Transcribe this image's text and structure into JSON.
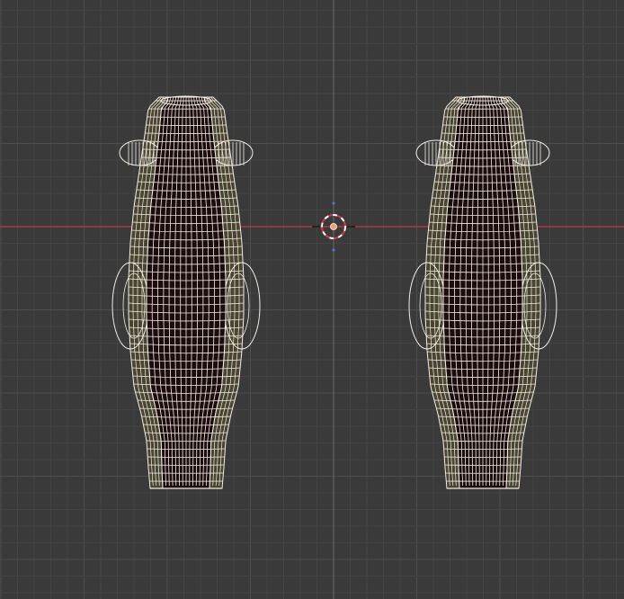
{
  "viewport": {
    "view": "orthographic-front",
    "shading": "wireframe",
    "colors": {
      "background": "#3a3a3a",
      "grid_minor": "#444444",
      "grid_major": "#4e4e4e",
      "x_axis": "#c0394a",
      "z_axis": "#4a78c0",
      "mesh_fill": "#1c0c0e",
      "mesh_side": "#4a4530",
      "wire": "#f2eee8",
      "cursor_red": "#e0334a",
      "cursor_white": "#ffffff",
      "origin_dot": "#f0a070"
    }
  },
  "scene": {
    "objects": [
      {
        "name": "mesh-left",
        "mirror": false
      },
      {
        "name": "mesh-right",
        "mirror": false
      }
    ],
    "cursor": {
      "icon": "3d-cursor-icon"
    },
    "origin": {
      "icon": "origin-dot-icon"
    }
  }
}
